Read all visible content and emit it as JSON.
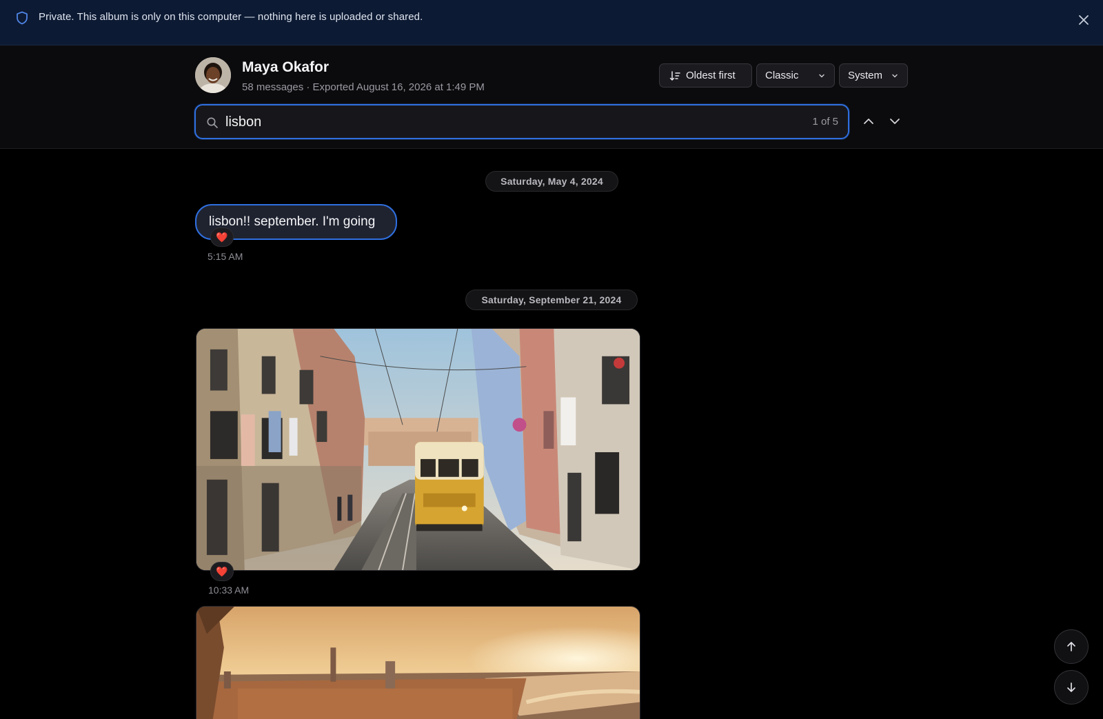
{
  "banner": {
    "text": "Private. This album is only on this computer — nothing here is uploaded or shared.",
    "icon": "shield-icon",
    "close_icon": "close-icon"
  },
  "header": {
    "name": "Maya Okafor",
    "meta": "58 messages · Exported August 16, 2026 at 1:49 PM",
    "sort_label": "Oldest first",
    "theme_value": "Classic",
    "mode_value": "System"
  },
  "search": {
    "value": "lisbon",
    "count": "1 of 5"
  },
  "messages": {
    "date_1": "Saturday, May 4, 2024",
    "text_1": "lisbon!! september. I'm going",
    "reaction_1": "❤️",
    "time_1": "5:15 AM",
    "date_2": "Saturday, September 21, 2024",
    "reaction_2": "❤️",
    "time_2": "10:33 AM"
  },
  "colors": {
    "accent": "#2f6fe0",
    "banner_bg": "#0d1a33",
    "bg": "#000000"
  }
}
